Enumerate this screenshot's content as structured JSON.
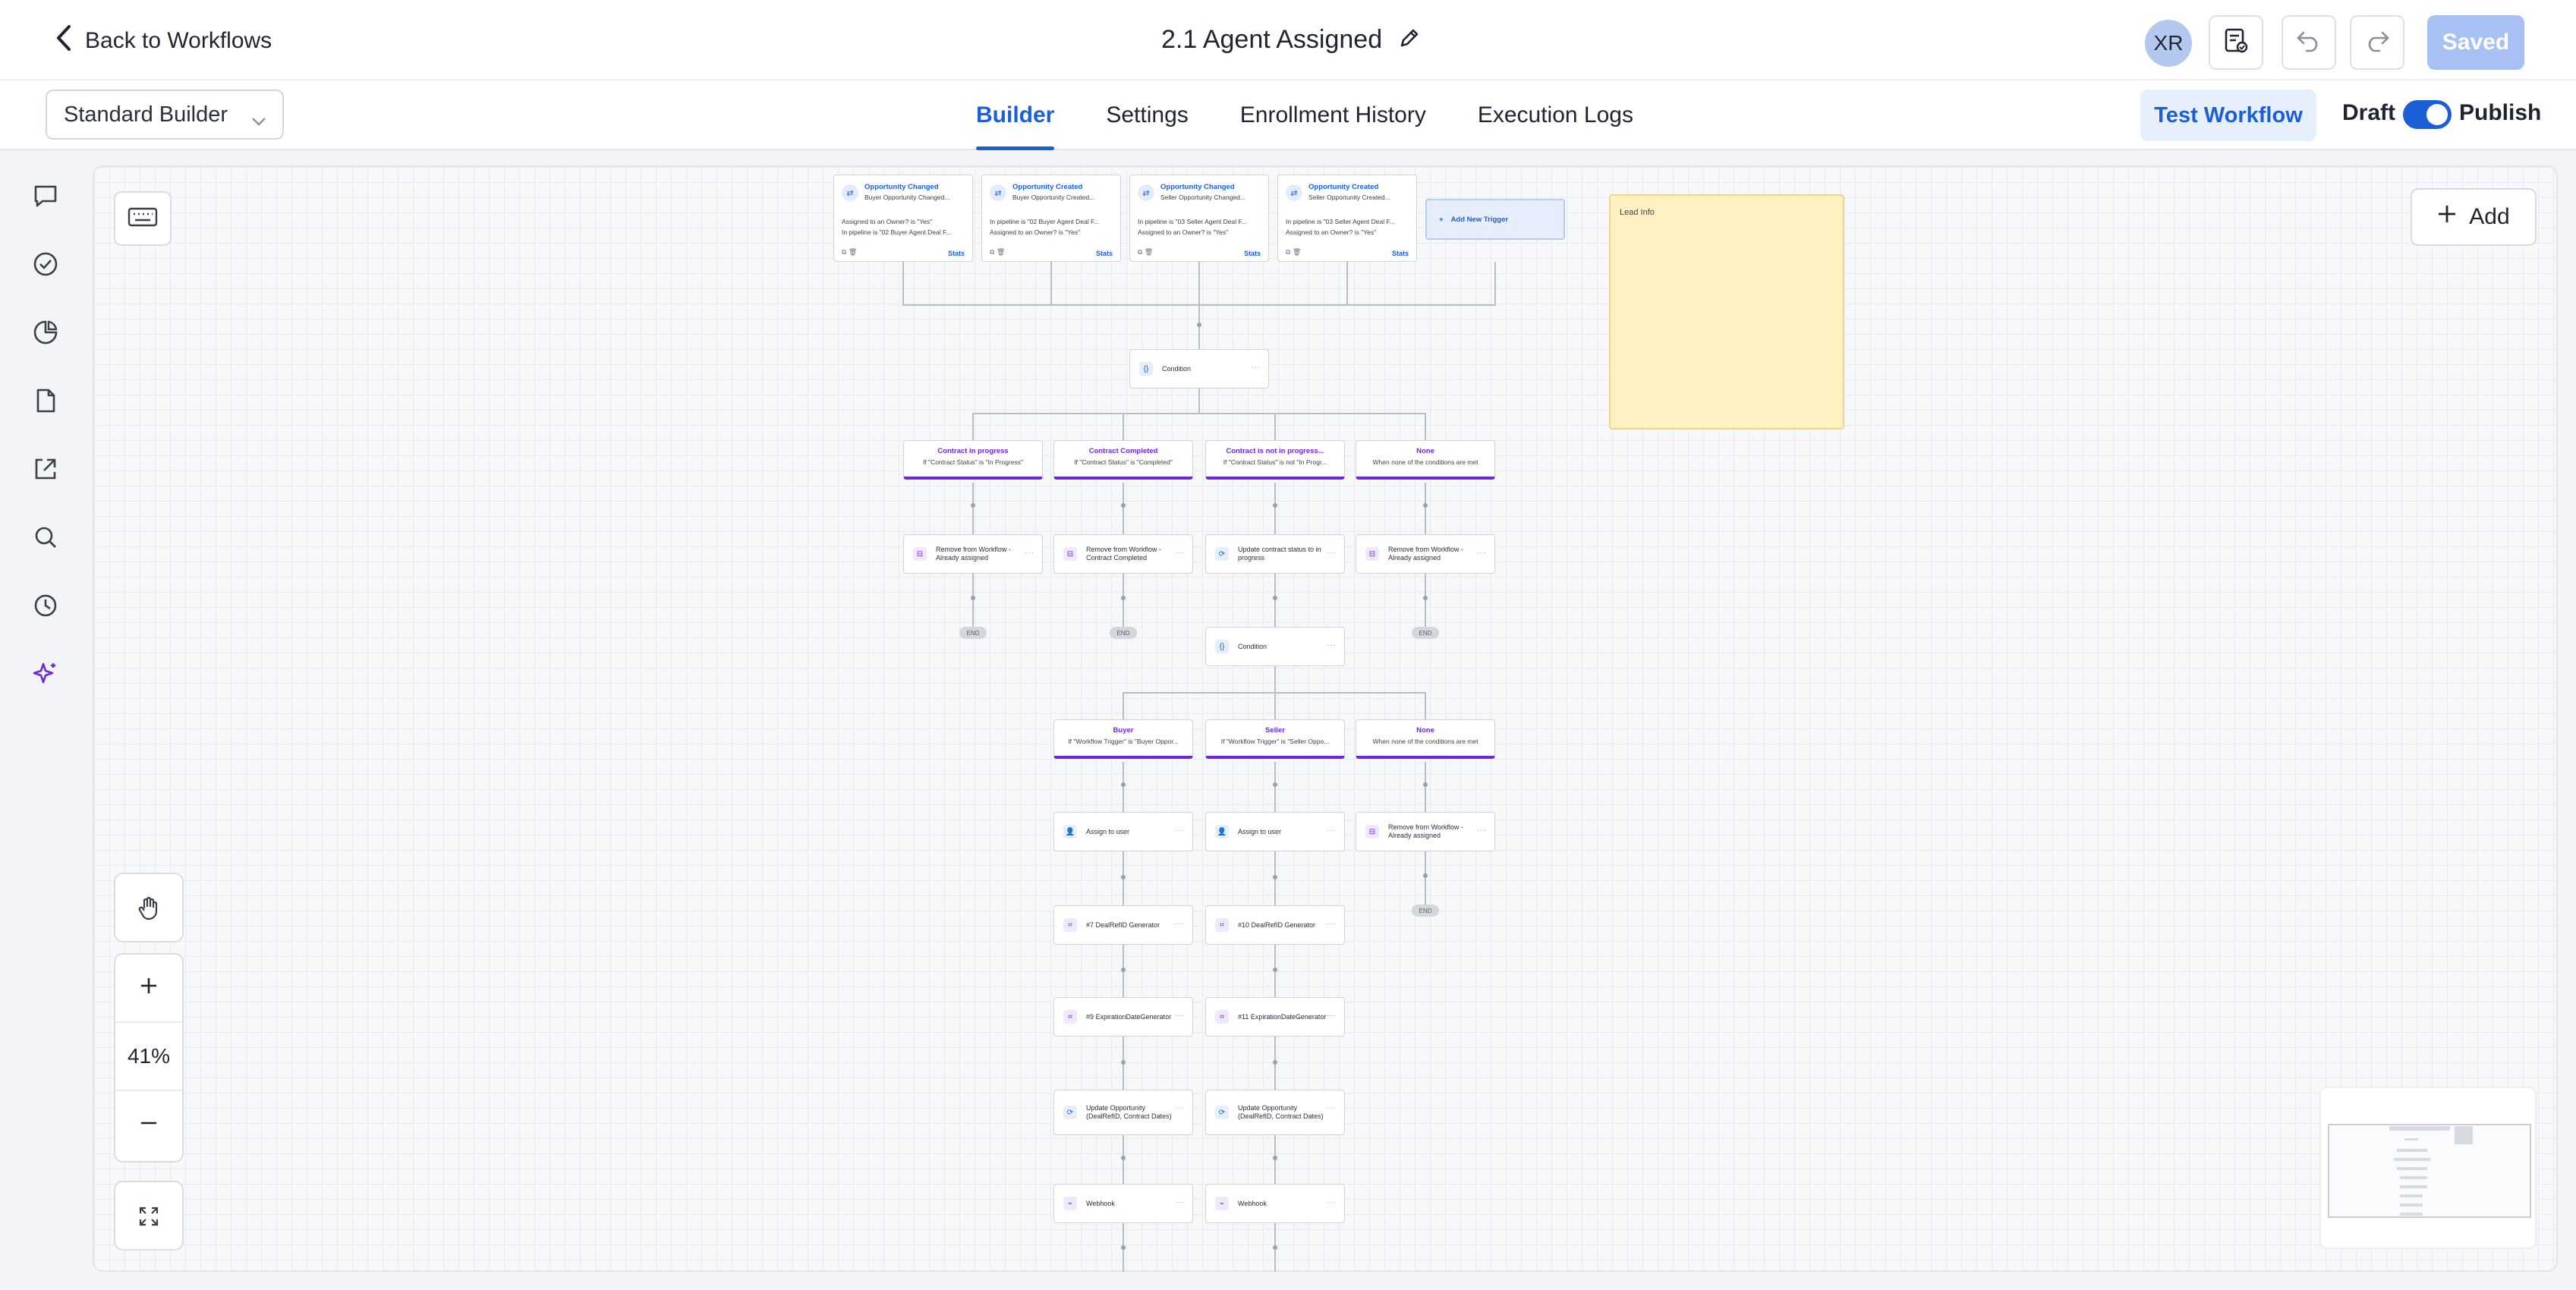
{
  "header": {
    "back_label": "Back to Workflows",
    "title": "2.1 Agent Assigned",
    "avatar_initials": "XR",
    "saved_label": "Saved"
  },
  "subbar": {
    "builder_mode": "Standard Builder",
    "tabs": [
      "Builder",
      "Settings",
      "Enrollment History",
      "Execution Logs"
    ],
    "active_tab": "Builder",
    "test_label": "Test Workflow",
    "draft_label": "Draft",
    "publish_label": "Publish"
  },
  "canvas": {
    "add_label": "Add",
    "zoom_level": "41%",
    "sticky_note": "Lead Info",
    "add_trigger_label": "Add New Trigger",
    "triggers": [
      {
        "title": "Opportunity Changed",
        "subtitle": "Buyer Opportunity Changed...",
        "line1": "Assigned to an Owner? is \"Yes\"",
        "line2": "In pipeline is \"02 Buyer Agent Deal F...",
        "stats": "Stats"
      },
      {
        "title": "Opportunity Created",
        "subtitle": "Buyer Opportunity Created...",
        "line1": "In pipeline is \"02 Buyer Agent Deal F...",
        "line2": "Assigned to an Owner? is \"Yes\"",
        "stats": "Stats"
      },
      {
        "title": "Opportunity Changed",
        "subtitle": "Seller Opportunity Changed...",
        "line1": "In pipeline is \"03 Seller Agent Deal F...",
        "line2": "Assigned to an Owner? is \"Yes\"",
        "stats": "Stats"
      },
      {
        "title": "Opportunity Created",
        "subtitle": "Seller Opportunity Created...",
        "line1": "In pipeline is \"03 Seller Agent Deal F...",
        "line2": "Assigned to an Owner? is \"Yes\"",
        "stats": "Stats"
      }
    ],
    "condition_label": "Condition",
    "branches_1": [
      {
        "title": "Contract in progress",
        "sub": "If \"Contract Status\" is \"In Progress\""
      },
      {
        "title": "Contract Completed",
        "sub": "If \"Contract Status\" is \"Completed\""
      },
      {
        "title": "Contract is not in progress...",
        "sub": "If \"Contract Status\" is not \"In Progr..."
      },
      {
        "title": "None",
        "sub": "When none of the conditions are met"
      }
    ],
    "actions_1": [
      "Remove from Workflow - Already assigned",
      "Remove from Workflow - Contract Completed",
      "Update contract status to in progress",
      "Remove from Workflow - Already assigned"
    ],
    "end_label": "END",
    "branches_2": [
      {
        "title": "Buyer",
        "sub": "If \"Workflow Trigger\" is \"Buyer Oppor..."
      },
      {
        "title": "Seller",
        "sub": "If \"Workflow Trigger\" is \"Seller Oppo..."
      },
      {
        "title": "None",
        "sub": "When none of the conditions are met"
      }
    ],
    "assign_label": "Assign to user",
    "remove_label": "Remove from Workflow - Already assigned",
    "buyer_steps": [
      "#7 DealRefID Generator",
      "#9 ExpirationDateGenerator",
      "Update Opportunity (DealRefID, Contract Dates)",
      "Webhook"
    ],
    "seller_steps": [
      "#10 DealRefID Generator",
      "#11 ExpirationDateGenerator",
      "Update Opportunity (DealRefID, Contract Dates)",
      "Webhook"
    ]
  }
}
